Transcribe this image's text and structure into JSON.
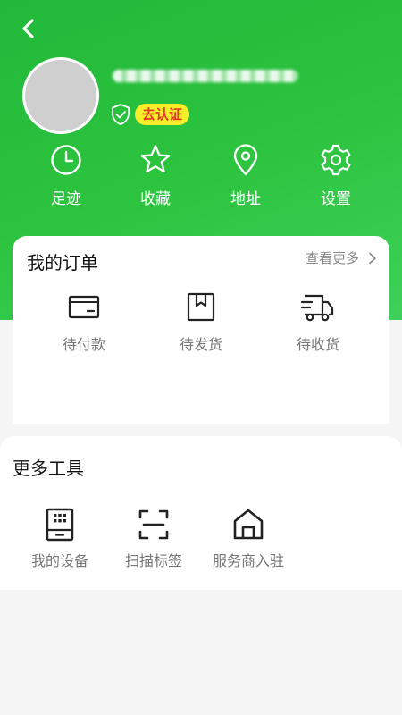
{
  "profile": {
    "nickname": "",
    "verify_label": "去认证"
  },
  "quick_links": [
    {
      "label": "足迹",
      "icon": "clock-icon"
    },
    {
      "label": "收藏",
      "icon": "star-icon"
    },
    {
      "label": "地址",
      "icon": "location-pin-icon"
    },
    {
      "label": "设置",
      "icon": "gear-icon"
    }
  ],
  "orders": {
    "title": "我的订单",
    "more_label": "查看更多",
    "items": [
      {
        "label": "待付款",
        "icon": "card-icon"
      },
      {
        "label": "待发货",
        "icon": "package-icon"
      },
      {
        "label": "待收货",
        "icon": "truck-icon"
      }
    ]
  },
  "tools": {
    "title": "更多工具",
    "items": [
      {
        "label": "我的设备",
        "icon": "device-icon"
      },
      {
        "label": "扫描标签",
        "icon": "scan-icon"
      },
      {
        "label": "服务商入驻",
        "icon": "store-icon"
      }
    ]
  },
  "colors": {
    "header_green": "#2cc33e",
    "badge_yellow": "#f6ee2a",
    "badge_text_red": "#e03a1e"
  }
}
